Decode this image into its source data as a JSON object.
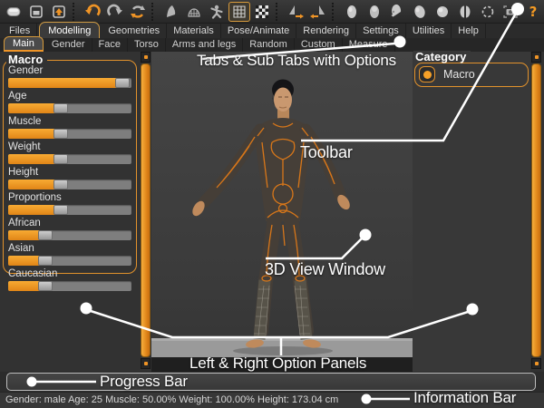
{
  "accent_color": "#ef9426",
  "toolbar": {
    "icons": [
      "new-document",
      "save",
      "export",
      "undo",
      "redo",
      "reset",
      "smooth",
      "wireframe",
      "pose",
      "grid",
      "background",
      "symmetry-right",
      "symmetry-left",
      "view-front",
      "view-back",
      "view-side",
      "view-three-quarter",
      "view-top",
      "view-split",
      "view-orbit",
      "screenshot",
      "help"
    ]
  },
  "tabs": {
    "main": [
      {
        "label": "Files",
        "active": false
      },
      {
        "label": "Modelling",
        "active": true
      },
      {
        "label": "Geometries",
        "active": false
      },
      {
        "label": "Materials",
        "active": false
      },
      {
        "label": "Pose/Animate",
        "active": false
      },
      {
        "label": "Rendering",
        "active": false
      },
      {
        "label": "Settings",
        "active": false
      },
      {
        "label": "Utilities",
        "active": false
      },
      {
        "label": "Help",
        "active": false
      }
    ],
    "sub": [
      {
        "label": "Main",
        "active": true
      },
      {
        "label": "Gender",
        "active": false
      },
      {
        "label": "Face",
        "active": false
      },
      {
        "label": "Torso",
        "active": false
      },
      {
        "label": "Arms and legs",
        "active": false
      },
      {
        "label": "Random",
        "active": false
      },
      {
        "label": "Custom",
        "active": false
      },
      {
        "label": "Measure",
        "active": false
      }
    ]
  },
  "left_panel": {
    "title": "Macro",
    "sliders": [
      {
        "label": "Gender",
        "value": 93
      },
      {
        "label": "Age",
        "value": 43
      },
      {
        "label": "Muscle",
        "value": 43
      },
      {
        "label": "Weight",
        "value": 43
      },
      {
        "label": "Height",
        "value": 43
      },
      {
        "label": "Proportions",
        "value": 43
      },
      {
        "label": "African",
        "value": 30
      },
      {
        "label": "Asian",
        "value": 30
      },
      {
        "label": "Caucasian",
        "value": 30
      }
    ]
  },
  "right_panel": {
    "title": "Category",
    "option": {
      "label": "Macro",
      "selected": true
    }
  },
  "annotations": {
    "tabs": "Tabs & Sub Tabs with Options",
    "toolbar": "Toolbar",
    "view": "3D View Window",
    "panels": "Left & Right Option Panels",
    "progress": "Progress Bar",
    "info": "Information Bar"
  },
  "info_bar": {
    "text": "Gender: male Age: 25 Muscle: 50.00% Weight: 100.00% Height: 173.04 cm"
  }
}
